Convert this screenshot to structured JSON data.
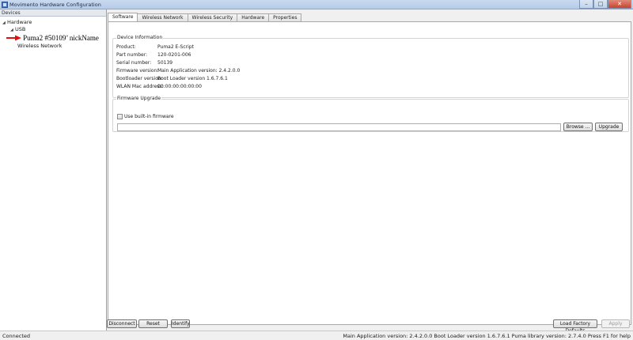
{
  "window": {
    "title": "Movimento Hardware Configuration",
    "minimize": "–",
    "maximize": "□",
    "close": "✕"
  },
  "devices_panel": {
    "header": "Devices",
    "tree": {
      "hardware": "Hardware",
      "usb": "USB",
      "puma": "Puma2 #50109’ nickName",
      "wireless": "Wireless Network"
    },
    "annotation_color": "#e01010"
  },
  "tabs": [
    "Software",
    "Wireless Network",
    "Wireless Security",
    "Hardware",
    "Properties"
  ],
  "active_tab": "Software",
  "device_info": {
    "title": "Device Information",
    "rows": [
      {
        "label": "Product:",
        "value": "Puma2 E-Script"
      },
      {
        "label": "Part number:",
        "value": "120-0201-006"
      },
      {
        "label": "Serial number:",
        "value": "50139"
      },
      {
        "label": "Firmware version:",
        "value": "Main Application version: 2.4.2.0.0"
      },
      {
        "label": "Bootloader version:",
        "value": "Boot Loader version 1.6.7.6.1"
      },
      {
        "label": "WLAN Mac address:",
        "value": "00:00:00:00:00:00"
      }
    ]
  },
  "firmware_upgrade": {
    "title": "Firmware Upgrade",
    "checkbox_label": "Use built-in firmware",
    "checkbox_checked": false,
    "path_value": "",
    "browse_label": "Browse ...",
    "upgrade_label": "Upgrade"
  },
  "bottom": {
    "disconnect": "Disconnect",
    "reset": "Reset",
    "identify": "Identify",
    "load_factory": "Load Factory Defaults",
    "apply": "Apply"
  },
  "status": {
    "left": "Connected",
    "right": "Main Application version: 2.4.2.0.0  Boot Loader version 1.6.7.6.1  Puma library version: 2.7.4.0  Press F1 for help"
  }
}
